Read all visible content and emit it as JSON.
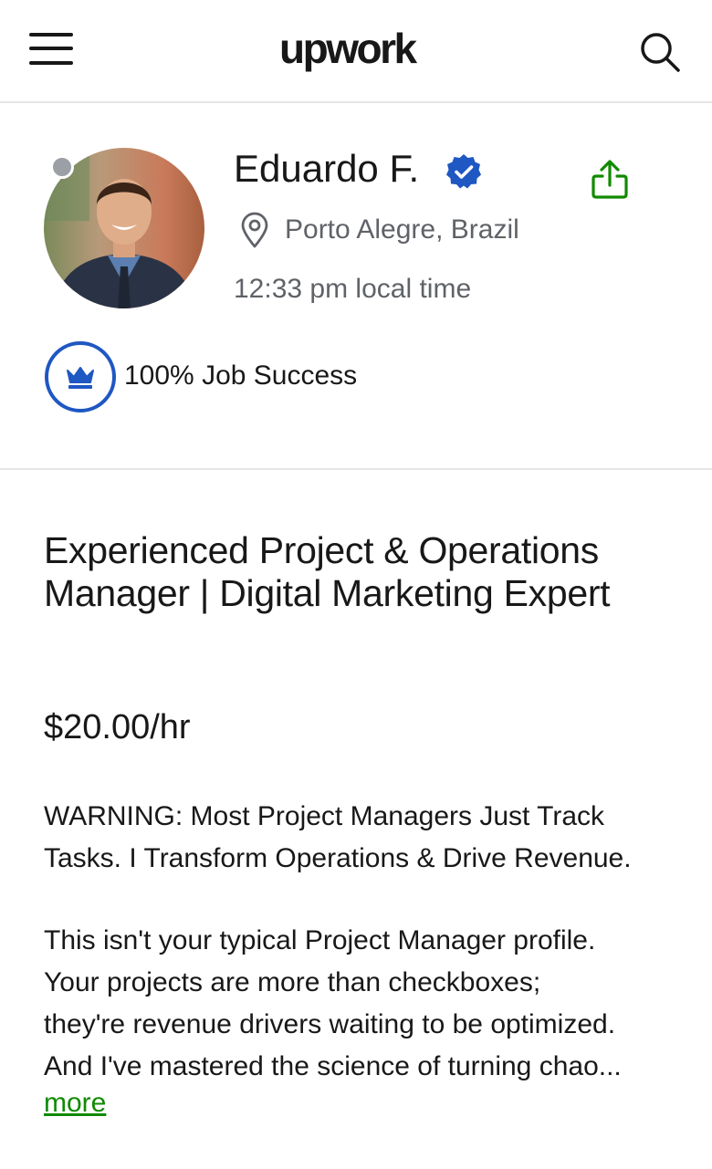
{
  "header": {
    "logo_text": "upwork",
    "menu_icon": "hamburger-menu-icon",
    "search_icon": "search-icon"
  },
  "profile": {
    "name": "Eduardo F.",
    "verified_icon": "verified-badge-icon",
    "share_icon": "share-icon",
    "location_icon": "location-pin-icon",
    "location": "Porto Alegre, Brazil",
    "local_time": "12:33 pm local time",
    "job_success": "100% Job Success",
    "job_success_icon": "crown-icon",
    "online_status_color": "#9aa0a6"
  },
  "main": {
    "title": "Experienced Project & Operations Manager | Digital Marketing Expert",
    "rate": "$20.00/hr",
    "description_p1": "WARNING: Most Project Managers Just Track\nTasks. I Transform Operations & Drive Revenue.",
    "description_p2": "This isn't your typical Project Manager profile.\nYour projects are more than checkboxes;\nthey're revenue drivers waiting to be optimized.\nAnd I've mastered the science of turning chao...",
    "more_label": "more"
  },
  "colors": {
    "accent_green": "#108a00",
    "verified_blue": "#1f57c3",
    "text": "#181818",
    "muted": "#5f6368",
    "divider": "#e4e5e7"
  }
}
